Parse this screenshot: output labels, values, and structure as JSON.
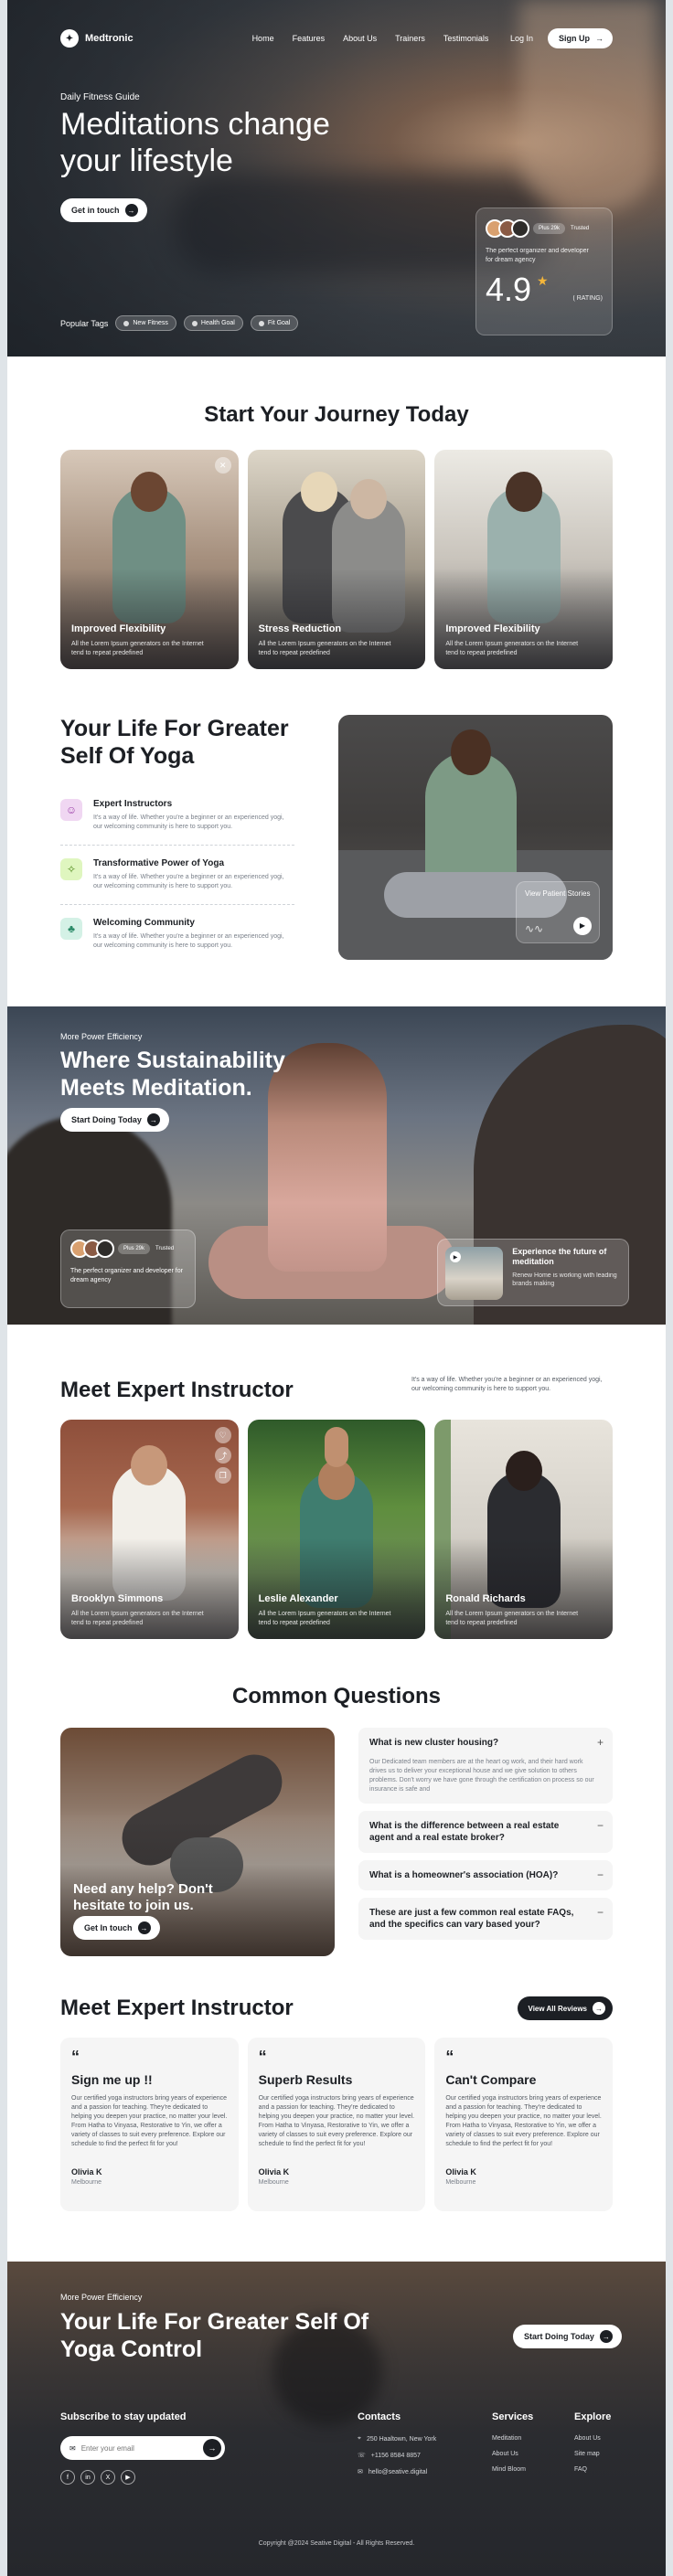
{
  "nav": {
    "logo": "Medtronic",
    "links": [
      "Home",
      "Features",
      "About Us",
      "Trainers",
      "Testimonials"
    ],
    "login": "Log In",
    "signup": "Sign Up"
  },
  "hero": {
    "kicker": "Daily Fitness Guide",
    "title": "Meditations change your lifestyle",
    "cta": "Get in touch",
    "tags_label": "Popular Tags",
    "tags": [
      "New Fitness",
      "Health Goal",
      "Fit Goal"
    ],
    "rating_chip": "Plus 29k",
    "rating_chip2": "Trusted",
    "rating_text": "The perfect organizer and developer for dream agency",
    "rating_value": "4.9",
    "rating_label": "( RATING)"
  },
  "journey": {
    "title": "Start Your Journey Today",
    "cards": [
      {
        "title": "Improved Flexibility",
        "desc": "All the Lorem Ipsum generators on the Internet tend to repeat predefined"
      },
      {
        "title": "Stress Reduction",
        "desc": "All the Lorem Ipsum generators on the Internet tend to repeat predefined"
      },
      {
        "title": "Improved Flexibility",
        "desc": "All the Lorem Ipsum generators on the Internet tend to repeat predefined"
      }
    ]
  },
  "yoga": {
    "title": "Your Life For Greater Self Of Yoga",
    "items": [
      {
        "title": "Expert Instructors",
        "desc": "It's a way of life. Whether you're a beginner or an experienced yogi, our welcoming community is here to support you."
      },
      {
        "title": "Transformative Power of Yoga",
        "desc": "It's a way of life. Whether you're a beginner or an experienced yogi, our welcoming community is here to support you."
      },
      {
        "title": "Welcoming Community",
        "desc": "It's a way of life. Whether you're a beginner or an experienced yogi, our welcoming community is here to support you."
      }
    ],
    "video_label": "View Patient Stories"
  },
  "banner": {
    "kicker": "More Power Efficiency",
    "title": "Where Sustainability Meets Meditation.",
    "cta": "Start Doing Today",
    "chip": "Plus 29k",
    "chip2": "Trusted",
    "rating_text": "The perfect organizer and developer for dream agency",
    "exp_title": "Experience the future of meditation",
    "exp_desc": "Renew Home is working with leading brands making"
  },
  "instructors": {
    "title": "Meet Expert Instructor",
    "desc": "It's a way of life. Whether you're a beginner or an experienced yogi, our welcoming community is here to support you.",
    "cards": [
      {
        "name": "Brooklyn Simmons",
        "desc": "All the Lorem Ipsum generators on the Internet tend to repeat predefined"
      },
      {
        "name": "Leslie Alexander",
        "desc": "All the Lorem Ipsum generators on the Internet tend to repeat predefined"
      },
      {
        "name": "Ronald Richards",
        "desc": "All the Lorem Ipsum generators on the Internet tend to repeat predefined"
      }
    ]
  },
  "faq": {
    "title": "Common Questions",
    "help": "Need any help? Don't hesitate to join us.",
    "cta": "Get In touch",
    "items": [
      {
        "q": "What is new cluster housing?",
        "a": "Our Dedicated team members are at the heart og work, and their hard work drives us to deliver your exceptional house and we give solution to others problems. Don't worry we have gone through the certification on process so our insurance is safe and",
        "toggle": "+"
      },
      {
        "q": "What is the difference between a real estate agent and a real estate broker?",
        "a": "",
        "toggle": "−"
      },
      {
        "q": "What is a homeowner's association (HOA)?",
        "a": "",
        "toggle": "−"
      },
      {
        "q": "These are just a few common real estate FAQs, and the specifics can vary based your?",
        "a": "",
        "toggle": "−"
      }
    ]
  },
  "reviews": {
    "title": "Meet Expert Instructor",
    "cta": "View All Reviews",
    "cards": [
      {
        "title": "Sign me up !!",
        "desc": "Our certified yoga instructors bring years of experience and a passion for teaching. They're dedicated to helping you deepen your practice, no matter your level. From Hatha to Vinyasa, Restorative to Yin, we offer a variety of classes to suit every preference. Explore our schedule to find the perfect fit for you!",
        "name": "Olivia K",
        "city": "Melbourne"
      },
      {
        "title": "Superb Results",
        "desc": "Our certified yoga instructors bring years of experience and a passion for teaching. They're dedicated to helping you deepen your practice, no matter your level. From Hatha to Vinyasa, Restorative to Yin, we offer a variety of classes to suit every preference. Explore our schedule to find the perfect fit for you!",
        "name": "Olivia K",
        "city": "Melbourne"
      },
      {
        "title": "Can't Compare",
        "desc": "Our certified yoga instructors bring years of experience and a passion for teaching. They're dedicated to helping you deepen your practice, no matter your level. From Hatha to Vinyasa, Restorative to Yin, we offer a variety of classes to suit every preference. Explore our schedule to find the perfect fit for you!",
        "name": "Olivia K",
        "city": "Melbourne"
      }
    ]
  },
  "footer": {
    "kicker": "More Power Efficiency",
    "title": "Your Life For Greater Self Of Yoga Control",
    "cta": "Start Doing Today",
    "subscribe": "Subscribe to stay updated",
    "email_placeholder": "Enter your email",
    "contacts_title": "Contacts",
    "contacts": [
      "250 Haaltown, New York",
      "+1156 8584 8857",
      "hello@seative.digital"
    ],
    "services_title": "Services",
    "services": [
      "Meditation",
      "About Us",
      "Mind Bloom"
    ],
    "explore_title": "Explore",
    "explore": [
      "About Us",
      "Site map",
      "FAQ"
    ],
    "copyright": "Copyright @2024 Seative Digital - All Rights Reserved."
  }
}
